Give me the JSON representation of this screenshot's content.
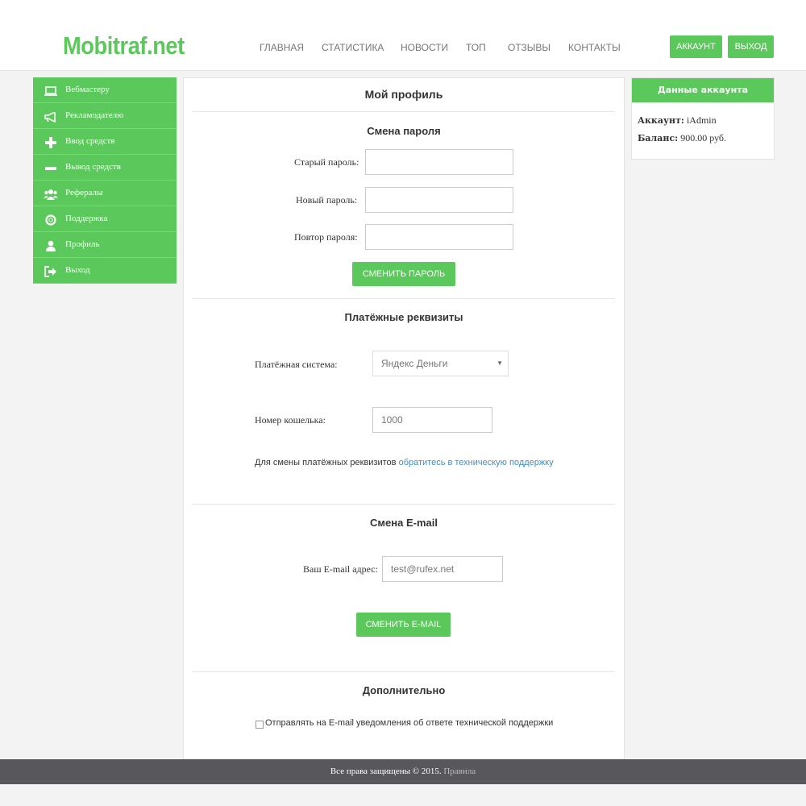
{
  "header": {
    "logo": "Mobitraf.net",
    "nav": [
      "ГЛАВНАЯ",
      "СТАТИСТИКА",
      "НОВОСТИ",
      "ТОП",
      "ОТЗЫВЫ",
      "КОНТАКТЫ"
    ],
    "account_button": "АККАУНТ",
    "logout_button": "ВЫХОД"
  },
  "sidebar": {
    "items": [
      {
        "label": "Вебмастеру",
        "icon": "laptop-icon"
      },
      {
        "label": "Рекламодателю",
        "icon": "megaphone-icon"
      },
      {
        "label": "Ввод средств",
        "icon": "plus-icon"
      },
      {
        "label": "Вывод средств",
        "icon": "minus-icon"
      },
      {
        "label": "Рефералы",
        "icon": "users-icon"
      },
      {
        "label": "Поддержка",
        "icon": "lifebuoy-icon"
      },
      {
        "label": "Профиль",
        "icon": "user-icon"
      },
      {
        "label": "Выход",
        "icon": "sign-out-icon"
      }
    ]
  },
  "profile": {
    "title": "Мой профиль",
    "password": {
      "title": "Смена пароля",
      "old_label": "Старый пароль:",
      "new_label": "Новый пароль:",
      "repeat_label": "Повтор пароля:",
      "old_value": "",
      "new_value": "",
      "repeat_value": "",
      "button": "СМЕНИТЬ ПАРОЛЬ"
    },
    "payment": {
      "title": "Платёжные реквизиты",
      "system_label": "Платёжная система:",
      "system_selected": "Яндекс Деньги",
      "wallet_label": "Номер кошелька:",
      "wallet_value": "1000",
      "note": "Для смены платёжных реквизитов",
      "note_link": "обратитесь в техническую поддержку"
    },
    "email": {
      "title": "Смена E-mail",
      "label": "Ваш E-mail адрес:",
      "value": "test@rufex.net",
      "button": "СМЕНИТЬ E-MAIL"
    },
    "extra": {
      "title": "Дополнительно",
      "checkbox_label": "Отправлять на E-mail уведомления об ответе технической поддержки",
      "checked": false
    }
  },
  "account": {
    "title": "Данные аккаунта",
    "account_label": "Аккаунт:",
    "account_value": "iAdmin",
    "balance_label": "Баланс:",
    "balance_value": "900.00 руб."
  },
  "footer": {
    "text": "Все права защищены © 2015.",
    "link": "Правила"
  },
  "colors": {
    "accent": "#5bc85b",
    "footer_bg": "#58585c",
    "link": "#3d8fc6"
  }
}
